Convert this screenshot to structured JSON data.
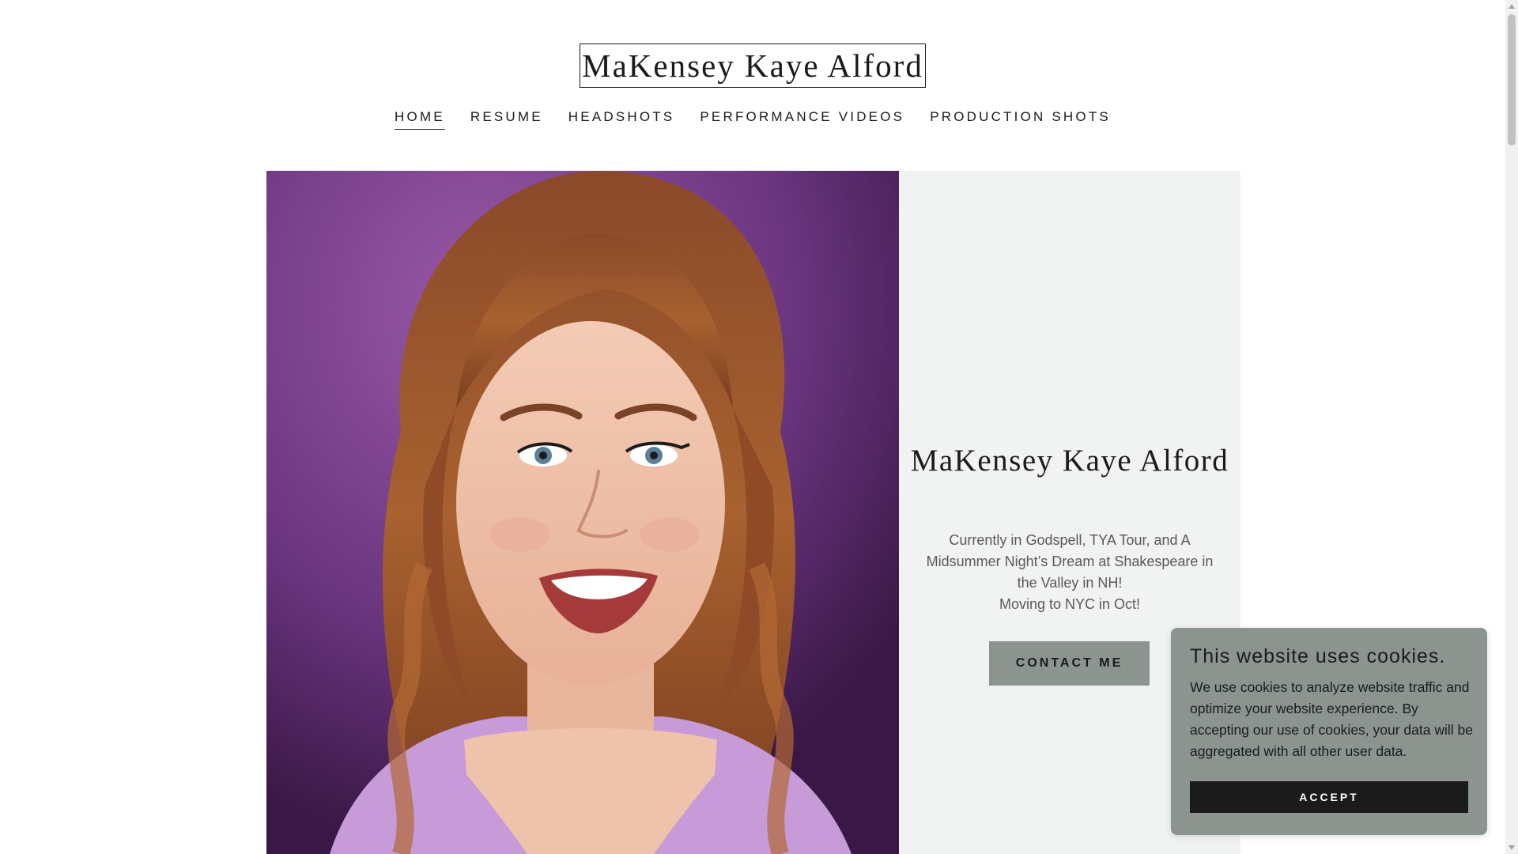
{
  "header": {
    "site_title": "MaKensey Kaye Alford"
  },
  "nav": {
    "items": [
      {
        "label": "HOME",
        "active": true
      },
      {
        "label": "RESUME",
        "active": false
      },
      {
        "label": "HEADSHOTS",
        "active": false
      },
      {
        "label": "PERFORMANCE VIDEOS",
        "active": false
      },
      {
        "label": "PRODUCTION SHOTS",
        "active": false
      }
    ]
  },
  "hero": {
    "heading": "MaKensey Kaye Alford",
    "description_line1": "Currently in Godspell, TYA Tour, and A Midsummer Night’s Dream at Shakespeare in the Valley in NH!",
    "description_line2": "Moving to NYC in Oct!",
    "cta_label": "CONTACT ME",
    "photo_icon": "headshot-photo"
  },
  "cookie_banner": {
    "title": "This website uses cookies.",
    "body": "We use cookies to analyze website traffic and optimize your website experience. By accepting our use of cookies, your data will be aggregated with all other user data.",
    "accept_label": "ACCEPT"
  },
  "colors": {
    "text": "#1b1b1b",
    "muted_text": "#595959",
    "panel_background": "#f1f3f2",
    "button_background": "#8b948f",
    "accept_background": "#1b1b1b",
    "photo_background": "#6e3680"
  }
}
